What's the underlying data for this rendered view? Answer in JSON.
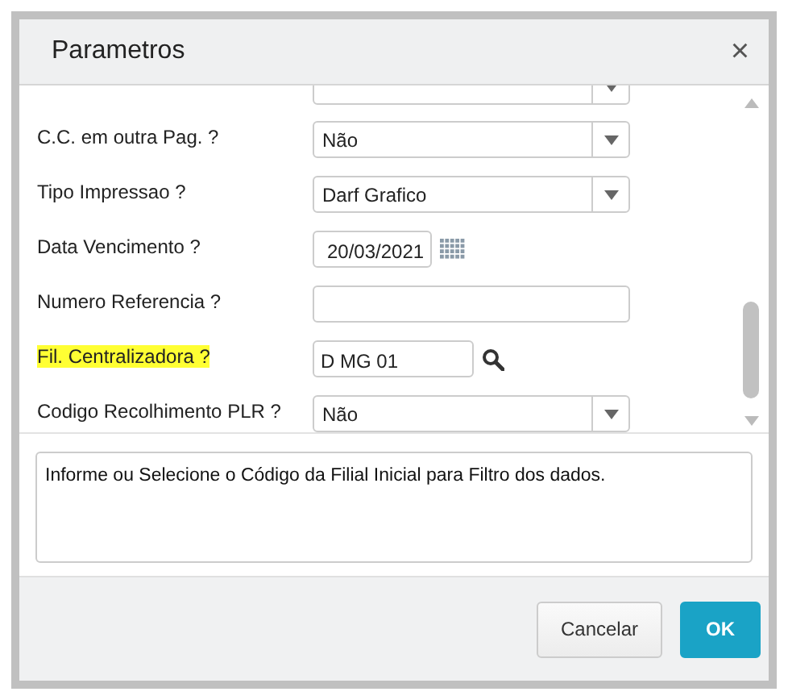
{
  "window": {
    "title": "Parametros",
    "close": "×"
  },
  "fields": [
    {
      "kind": "select"
    },
    {
      "kind": "select",
      "label": "C.C. em outra Pag. ?",
      "value": "Não",
      "highlighted": false
    },
    {
      "kind": "select",
      "label": "Tipo Impressao ?",
      "value": "Darf Grafico",
      "highlighted": false
    },
    {
      "kind": "date",
      "label": "Data Vencimento ?",
      "value": "20/03/2021",
      "highlighted": false
    },
    {
      "kind": "text",
      "label": "Numero Referencia ?",
      "highlighted": false
    },
    {
      "kind": "lookup",
      "label": "Fil. Centralizadora ?",
      "value": "D MG 01",
      "highlighted": true
    },
    {
      "kind": "select",
      "label": "Codigo Recolhimento PLR ?",
      "value": "Não",
      "highlighted": false
    }
  ],
  "description": "Informe ou Selecione o Código da Filial Inicial para Filtro dos dados.",
  "buttons": [
    {
      "label": "Cancelar",
      "kind": "secondary"
    },
    {
      "label": "OK",
      "kind": "primary"
    }
  ]
}
